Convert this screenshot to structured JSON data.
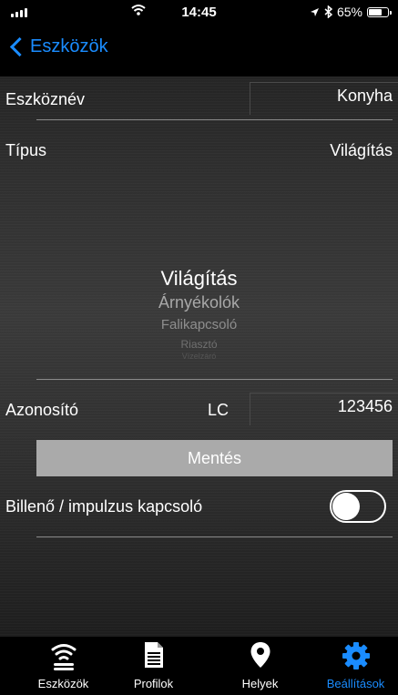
{
  "status_bar": {
    "time": "14:45",
    "battery": "65%",
    "battery_level": 0.65
  },
  "nav": {
    "back_label": "Eszközök"
  },
  "form": {
    "name_label": "Eszköznév",
    "name_value": "Konyha",
    "type_label": "Típus",
    "type_value": "Világítás",
    "picker_options": [
      "Világítás",
      "Árnyékolók",
      "Falikapcsoló",
      "Riasztó",
      "Vízelzáró"
    ],
    "id_label": "Azonosító",
    "id_prefix": "LC",
    "id_value": "123456",
    "save_label": "Mentés",
    "toggle_label": "Billenő / impulzus kapcsoló",
    "toggle_on": false
  },
  "tabs": [
    {
      "label": "Eszközök",
      "icon": "wifi-icon",
      "active": false
    },
    {
      "label": "Profilok",
      "icon": "document-icon",
      "active": false
    },
    {
      "label": "Helyek",
      "icon": "location-pin-icon",
      "active": false
    },
    {
      "label": "Beállítások",
      "icon": "gear-icon",
      "active": true
    }
  ],
  "colors": {
    "accent": "#1a8cff",
    "save_button": "#aaaaaa"
  }
}
